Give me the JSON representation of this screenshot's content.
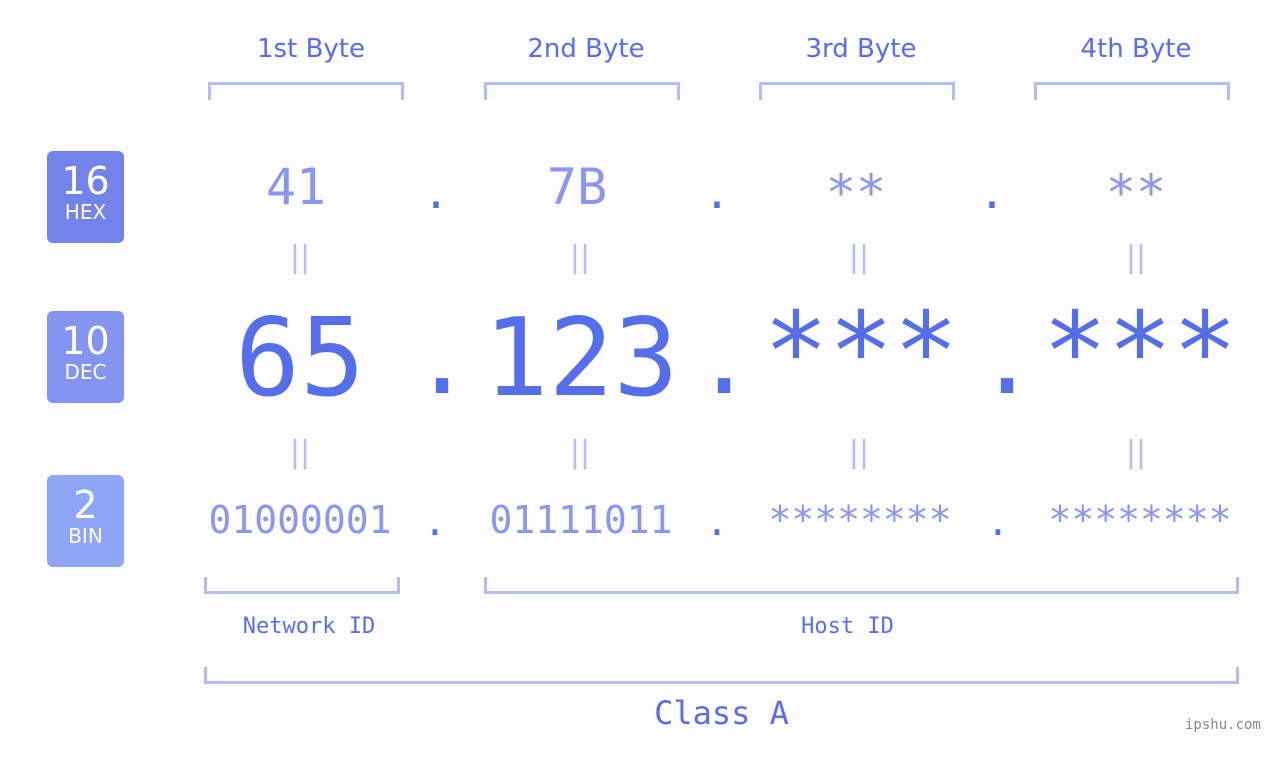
{
  "bytes": [
    {
      "header": "1st Byte",
      "hex": "41",
      "dec": "65",
      "bin": "01000001"
    },
    {
      "header": "2nd Byte",
      "hex": "7B",
      "dec": "123",
      "bin": "01111011"
    },
    {
      "header": "3rd Byte",
      "hex": "**",
      "dec": "***",
      "bin": "********"
    },
    {
      "header": "4th Byte",
      "hex": "**",
      "dec": "***",
      "bin": "********"
    }
  ],
  "badges": {
    "hex": {
      "number": "16",
      "label": "HEX",
      "color": "#7383ea"
    },
    "dec": {
      "number": "10",
      "label": "DEC",
      "color": "#8494f0"
    },
    "bin": {
      "number": "2",
      "label": "BIN",
      "color": "#8fa6f7"
    }
  },
  "separator": ".",
  "equals": "=",
  "labels": {
    "network": "Network ID",
    "host": "Host ID",
    "class": "Class A"
  },
  "watermark": "ipshu.com"
}
